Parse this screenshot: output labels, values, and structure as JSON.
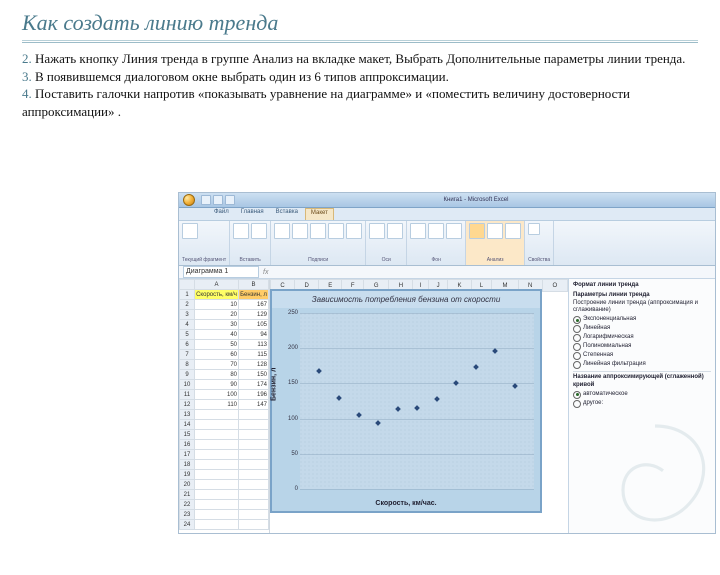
{
  "slide": {
    "title": "Как создать линию тренда",
    "items": [
      {
        "num": "2.",
        "text": "Нажать кнопку Линия тренда в группе Анализ на вкладке макет, Выбрать Дополнительные параметры линии тренда."
      },
      {
        "num": "3.",
        "text": "В появившемся диалоговом окне выбрать один из 6 типов аппроксимации."
      },
      {
        "num": "4.",
        "text": "Поставить галочки напротив «показывать уравнение на диаграмме» и «поместить величину достоверности"
      }
    ],
    "tail": "аппроксимации» ."
  },
  "excel": {
    "title_center": "Книга1 - Microsoft Excel",
    "tabs": [
      "Файл",
      "Главная",
      "Вставка",
      "Макет"
    ],
    "ribbon_groups": [
      "Текущий фрагмент",
      "Вставить",
      "Подписи",
      "Оси",
      "Фон",
      "Анализ",
      "Свойства"
    ],
    "namebox": "Диаграмма 1",
    "sheet": {
      "cols": [
        "A",
        "B"
      ],
      "hdr": [
        "Скорость, км/ч",
        "Бензин, л"
      ],
      "rows": [
        [
          "10",
          "167"
        ],
        [
          "20",
          "129"
        ],
        [
          "30",
          "105"
        ],
        [
          "40",
          "94"
        ],
        [
          "50",
          "113"
        ],
        [
          "60",
          "115"
        ],
        [
          "70",
          "128"
        ],
        [
          "80",
          "150"
        ],
        [
          "90",
          "174"
        ],
        [
          "100",
          "196"
        ],
        [
          "110",
          "147"
        ]
      ]
    },
    "extra_cols": [
      "C",
      "D",
      "E",
      "F",
      "G",
      "H",
      "I",
      "J",
      "K",
      "L",
      "M",
      "N",
      "O"
    ]
  },
  "chart_data": {
    "type": "scatter",
    "title": "Зависимость потребления бензина от скорости",
    "xlabel": "Скорость, км/час.",
    "ylabel": "Бензин, л",
    "x": [
      10,
      20,
      30,
      40,
      50,
      60,
      70,
      80,
      90,
      100,
      110
    ],
    "y": [
      167,
      129,
      105,
      94,
      113,
      115,
      128,
      150,
      174,
      196,
      147
    ],
    "xlim": [
      0,
      120
    ],
    "ylim": [
      0,
      250
    ],
    "yticks": [
      0,
      50,
      100,
      150,
      200,
      250
    ]
  },
  "trend_panel": {
    "header": "Формат линии тренда",
    "section": "Параметры линии тренда",
    "sub": "Построение линии тренда (аппроксимация и сглаживание)",
    "options": [
      "Экспоненциальная",
      "Линейная",
      "Логарифмическая",
      "Полиномиальная",
      "Степенная",
      "Линейная фильтрация"
    ],
    "selected": 0,
    "name_section": "Название аппроксимирующей (сглаженной) кривой",
    "auto": "автоматическое",
    "other_opt": "другое:"
  }
}
